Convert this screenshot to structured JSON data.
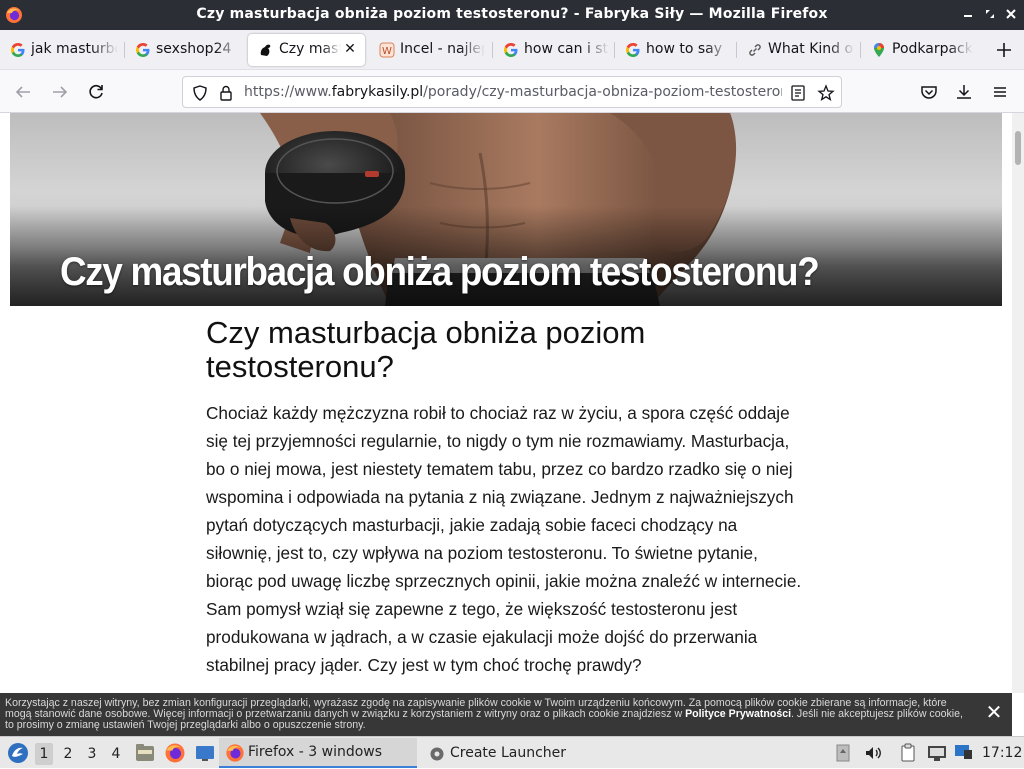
{
  "window": {
    "title": "Czy masturbacja obniża poziom testosteronu? - Fabryka Siły — Mozilla Firefox"
  },
  "tabs": [
    {
      "label": "jak masturbować",
      "icon": "google-icon",
      "active": false
    },
    {
      "label": "sexshop24",
      "icon": "google-icon",
      "active": false
    },
    {
      "label": "Czy masturbacja obniża",
      "icon": "fabryka-sily-icon",
      "active": true
    },
    {
      "label": "Incel - najlepsze",
      "icon": "wiki-icon",
      "active": false
    },
    {
      "label": "how can i stop",
      "icon": "google-icon",
      "active": false
    },
    {
      "label": "how to say",
      "icon": "google-icon",
      "active": false
    },
    {
      "label": "What Kind of",
      "icon": "link-icon",
      "active": false
    },
    {
      "label": "Podkarpackie",
      "icon": "maps-pin-icon",
      "active": false
    }
  ],
  "nav": {
    "url_prefix": "https://www.",
    "url_host": "fabrykasily.pl",
    "url_path": "/porady/czy-masturbacja-obniza-poziom-testosteronu"
  },
  "article": {
    "hero_title": "Czy masturbacja obniża poziom testosteronu?",
    "title": "Czy masturbacja obniża poziom testosteronu?",
    "body": "Chociaż każdy mężczyzna robił to chociaż raz w życiu, a spora część oddaje się tej przyjemności regularnie, to nigdy o tym nie rozmawiamy. Masturbacja, bo o niej mowa, jest niestety tematem tabu, przez co bardzo rzadko się o niej wspomina i odpowiada na pytania z nią związane. Jednym z najważniejszych pytań dotyczących masturbacji, jakie zadają sobie faceci chodzący na siłownię, jest to, czy wpływa na poziom testosteronu. To świetne pytanie, biorąc pod uwagę liczbę sprzecznych opinii, jakie można znaleźć w internecie. Sam pomysł wziął się zapewne z tego, że większość testosteronu jest produkowana w jądrach, a w czasie ejakulacji może dojść do przerwania stabilnej pracy jąder. Czy jest w tym choć trochę prawdy?"
  },
  "cookie": {
    "text": "Korzystając z naszej witryny, bez zmian konfiguracji przeglądarki, wyrażasz zgodę na zapisywanie plików cookie w Twoim urządzeniu końcowym. Za pomocą plików cookie zbierane są informacje, które mogą stanowić dane osobowe. Więcej informacji o przetwarzaniu danych w związku z korzystaniem z witryny oraz o plikach cookie znajdziesz w ",
    "link": "Polityce Prywatności",
    "text_after": ". Jeśli nie akceptujesz plików cookie, to prosimy o zmianę ustawień Twojej przeglądarki albo o opuszczenie strony.",
    "close_label": "✕"
  },
  "taskbar": {
    "workspaces": [
      "1",
      "2",
      "3",
      "4"
    ],
    "active_workspace": "1",
    "firefox_task": "Firefox - 3 windows",
    "launcher_task": "Create Launcher",
    "clock": "17:12"
  },
  "colors": {
    "titlebar_bg": "#2b2f35",
    "taskbar_accent": "#3c7fd6",
    "cookie_bg": "#282828"
  }
}
